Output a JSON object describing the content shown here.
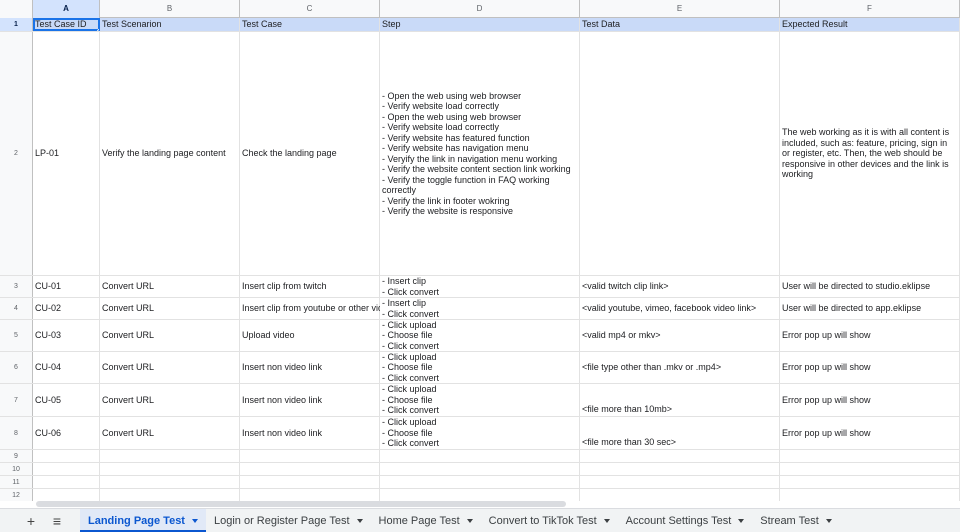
{
  "columns": [
    "A",
    "B",
    "C",
    "D",
    "E",
    "F"
  ],
  "row_numbers": [
    "1",
    "2",
    "3",
    "4",
    "5",
    "6",
    "7",
    "8",
    "9",
    "10",
    "11",
    "12"
  ],
  "rows": [
    [
      "Test Case ID",
      "Test Scenarion",
      "Test Case",
      "Step",
      "Test Data",
      "Expected Result"
    ],
    [
      "LP-01",
      "Verify the landing page content",
      "Check the landing page",
      "- Open the web using web browser\n- Verify website load correctly\n- Open the web using web browser\n- Verify website load correctly\n- Verify website has featured function\n- Verify website has navigation menu\n- Veryify the link in navigation menu working\n- Verify the website content section link working\n- Verify the toggle function in FAQ working correctly\n- Verify the link in footer wokring\n- Verify the website is responsive",
      "",
      "The web working as it is with all content is included, such as: feature, pricing, sign in or register, etc. Then, the web should be responsive in other devices and the link is working"
    ],
    [
      "CU-01",
      "Convert URL",
      "Insert clip from twitch",
      "- Insert clip\n- Click convert",
      "<valid twitch clip link>",
      "User will be directed to studio.eklipse"
    ],
    [
      "CU-02",
      "Convert URL",
      "Insert clip from youtube or other vid",
      "- Insert clip\n- Click convert",
      "<valid youtube, vimeo, facebook video link>",
      "User will be directed to app.eklipse"
    ],
    [
      "CU-03",
      "Convert URL",
      "Upload video",
      "- Click upload\n- Choose file\n- Click convert",
      "<valid mp4 or mkv>",
      "Error pop up will show"
    ],
    [
      "CU-04",
      "Convert URL",
      "Insert non video link",
      "- Click upload\n- Choose file\n- Click convert",
      "<file type other than .mkv or .mp4>",
      "Error pop up will show"
    ],
    [
      "CU-05",
      "Convert URL",
      "Insert non video link",
      "- Click upload\n- Choose file\n- Click convert",
      "<file more than 10mb>",
      "Error pop up will show"
    ],
    [
      "CU-06",
      "Convert URL",
      "Insert non video link",
      "- Click upload\n- Choose file\n- Click convert",
      "<file more than 30 sec>",
      "Error pop up will show"
    ],
    [
      "",
      "",
      "",
      "",
      "",
      ""
    ],
    [
      "",
      "",
      "",
      "",
      "",
      ""
    ],
    [
      "",
      "",
      "",
      "",
      "",
      ""
    ],
    [
      "",
      "",
      "",
      "",
      "",
      ""
    ]
  ],
  "tabbar": {
    "add_icon": "+",
    "menu_icon": "≡",
    "tabs": [
      "Landing Page Test",
      "Login or Register Page Test",
      "Home Page Test",
      "Convert to TikTok Test",
      "Account Settings Test",
      "Stream Test"
    ]
  }
}
